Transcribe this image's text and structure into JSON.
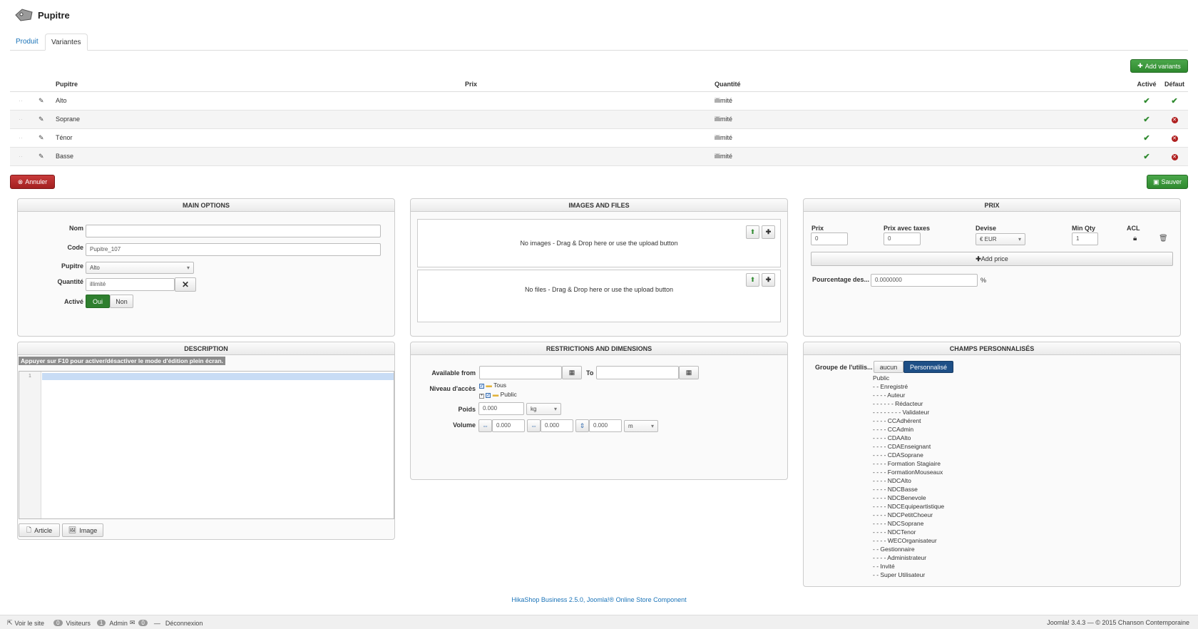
{
  "page": {
    "title": "Pupitre"
  },
  "tabs": [
    {
      "label": "Produit"
    },
    {
      "label": "Variantes"
    }
  ],
  "add_variants_label": "Add variants",
  "variants_table": {
    "headers": {
      "name": "Pupitre",
      "price": "Prix",
      "quantity": "Quantité",
      "active": "Activé",
      "default": "Défaut"
    },
    "rows": [
      {
        "name": "Alto",
        "price": "",
        "quantity": "illimité",
        "active": true,
        "default": true
      },
      {
        "name": "Soprane",
        "price": "",
        "quantity": "illimité",
        "active": true,
        "default": false
      },
      {
        "name": "Ténor",
        "price": "",
        "quantity": "illimité",
        "active": true,
        "default": false
      },
      {
        "name": "Basse",
        "price": "",
        "quantity": "illimité",
        "active": true,
        "default": false
      }
    ]
  },
  "cancel_label": "Annuler",
  "save_label": "Sauver",
  "main_options": {
    "title": "MAIN OPTIONS",
    "nom_label": "Nom",
    "nom_value": "",
    "code_label": "Code",
    "code_value": "Pupitre_107",
    "pupitre_label": "Pupitre",
    "pupitre_value": "Alto",
    "quantite_label": "Quantité",
    "quantite_value": "illimité",
    "active_label": "Activé",
    "oui": "Oui",
    "non": "Non"
  },
  "images_files": {
    "title": "IMAGES AND FILES",
    "no_images": "No images - Drag & Drop here or use the upload button",
    "no_files": "No files - Drag & Drop here or use the upload button"
  },
  "prix": {
    "title": "PRIX",
    "headers": {
      "prix": "Prix",
      "prix_taxes": "Prix avec taxes",
      "devise": "Devise",
      "min_qty": "Min Qty",
      "acl": "ACL"
    },
    "row": {
      "prix": "0",
      "prix_taxes": "0",
      "devise": "€ EUR",
      "min_qty": "1"
    },
    "add_price": "Add price",
    "pourcentage_label": "Pourcentage des...",
    "pourcentage_value": "0.0000000",
    "percent": "%"
  },
  "description": {
    "title": "DESCRIPTION",
    "hint": "Appuyer sur F10 pour activer/désactiver le mode d'édition plein écran.",
    "line_number": "1",
    "article_btn": "Article",
    "image_btn": "Image"
  },
  "restrictions": {
    "title": "RESTRICTIONS AND DIMENSIONS",
    "available_from": "Available from",
    "to": "To",
    "niveau_acces": "Niveau d'accès",
    "tree": [
      "Tous",
      "Public"
    ],
    "poids": "Poids",
    "poids_value": "0.000",
    "poids_unit": "kg",
    "volume": "Volume",
    "vol_values": [
      "0.000",
      "0.000",
      "0.000"
    ],
    "vol_unit": "m"
  },
  "champs": {
    "title": "CHAMPS PERSONNALISÉS",
    "groupe_label": "Groupe de l'utilis...",
    "aucun": "aucun",
    "personnalise": "Personnalisé",
    "groups": [
      "Public",
      "- - Enregistré",
      "- - - - Auteur",
      "- - - - - - Rédacteur",
      "- - - - - - - - Validateur",
      "- - - - CCAdhérent",
      "- - - - CCAdmin",
      "- - - - CDAAlto",
      "- - - - CDAEnseignant",
      "- - - - CDASoprane",
      "- - - - Formation Stagiaire",
      "- - - - FormationMouseaux",
      "- - - - NDCAlto",
      "- - - - NDCBasse",
      "- - - - NDCBenevole",
      "- - - - NDCEquipeartistique",
      "- - - - NDCPetitChoeur",
      "- - - - NDCSoprane",
      "- - - - NDCTenor",
      "- - - - WECOrganisateur",
      "- - Gestionnaire",
      "- - - - Administrateur",
      "- - Invité",
      "- - Super Utilisateur"
    ]
  },
  "footer_link": "HikaShop Business 2.5.0, Joomla!® Online Store Component",
  "status_bar": {
    "voir_site": "Voir le site",
    "visitors_count": "0",
    "visitors_label": "Visiteurs",
    "admin_count": "1",
    "admin_label": "Admin",
    "messages_count": "0",
    "logout": "Déconnexion",
    "right": "Joomla! 3.4.3 — © 2015 Chanson Contemporaine"
  }
}
